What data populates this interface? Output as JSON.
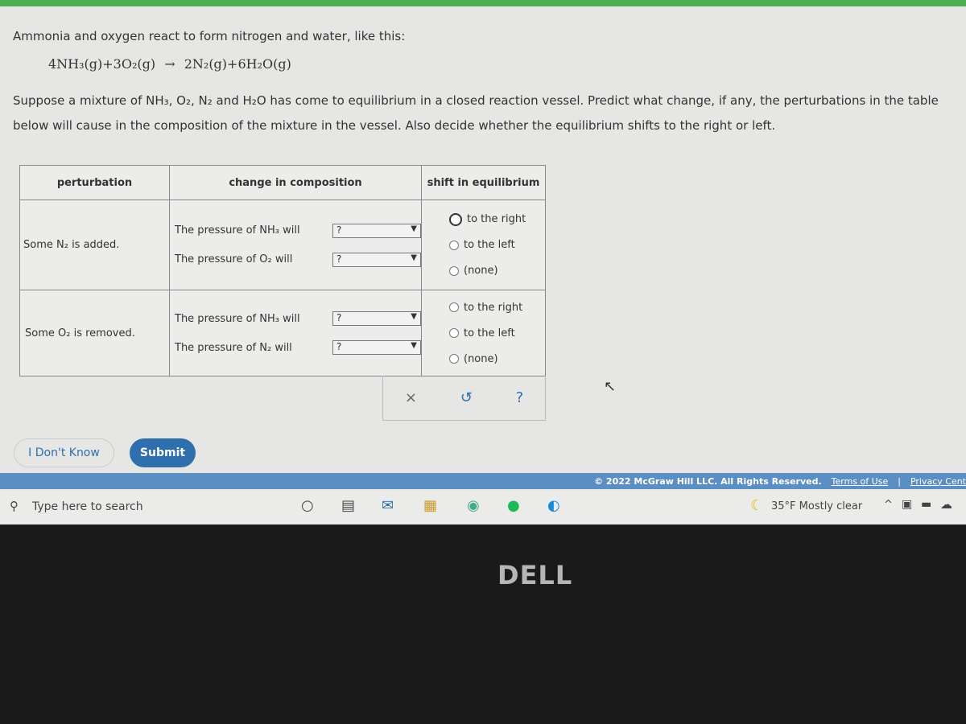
{
  "intro": "Ammonia and oxygen react to form nitrogen and water, like this:",
  "equation": {
    "reactants": "4NH₃(g)+3O₂(g)",
    "arrow": "→",
    "products": "2N₂(g)+6H₂O(g)"
  },
  "question_line1": "Suppose a mixture of NH₃, O₂, N₂ and H₂O has come to equilibrium in a closed reaction vessel. Predict what change, if any, the perturbations in the table",
  "question_line2": "below will cause in the composition of the mixture in the vessel. Also decide whether the equilibrium shifts to the right or left.",
  "table": {
    "headers": [
      "perturbation",
      "change in composition",
      "shift in equilibrium"
    ],
    "rows": [
      {
        "perturbation": "Some N₂ is added.",
        "changes": [
          {
            "label": "The pressure of NH₃ will",
            "value": "?"
          },
          {
            "label": "The pressure of O₂ will",
            "value": "?"
          }
        ],
        "options": [
          "to the right",
          "to the left",
          "(none)"
        ],
        "selected": 0
      },
      {
        "perturbation": "Some O₂ is removed.",
        "changes": [
          {
            "label": "The pressure of NH₃ will",
            "value": "?"
          },
          {
            "label": "The pressure of N₂ will",
            "value": "?"
          }
        ],
        "options": [
          "to the right",
          "to the left",
          "(none)"
        ],
        "selected": null
      }
    ]
  },
  "check_icons": {
    "clear": "×",
    "undo": "↺",
    "help": "?"
  },
  "buttons": {
    "dont_know": "I Don't Know",
    "submit": "Submit"
  },
  "footer": {
    "copyright": "© 2022 McGraw Hill LLC. All Rights Reserved.",
    "terms": "Terms of Use",
    "sep": "|",
    "privacy": "Privacy Cent"
  },
  "taskbar": {
    "search_placeholder": "Type here to search",
    "weather": "35°F  Mostly clear"
  },
  "brand": "DELL",
  "colors": {
    "accent": "#2f6fad",
    "footer": "#5b8ec2",
    "topbar": "#4caf50"
  }
}
